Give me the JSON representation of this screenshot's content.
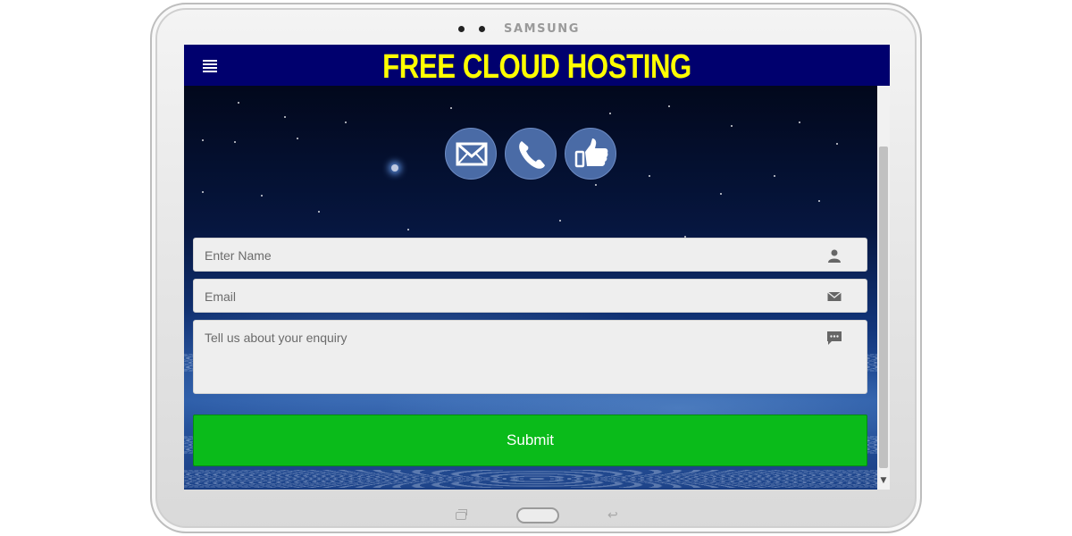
{
  "device": {
    "brand": "SAMSUNG"
  },
  "header": {
    "title": "FREE CLOUD HOSTING",
    "title_color": "#ffff00",
    "background_color": "#00006e",
    "menu_icon": "hamburger-menu-icon"
  },
  "social": [
    {
      "icon": "email-icon"
    },
    {
      "icon": "phone-icon"
    },
    {
      "icon": "thumbs-up-icon"
    }
  ],
  "form": {
    "name_placeholder": "Enter Name",
    "email_placeholder": "Email",
    "message_placeholder": "Tell us about your enquiry",
    "name_icon": "user-icon",
    "email_icon": "envelope-icon",
    "message_icon": "chat-bubble-icon",
    "submit_label": "Submit",
    "submit_color": "#0abb1a"
  }
}
